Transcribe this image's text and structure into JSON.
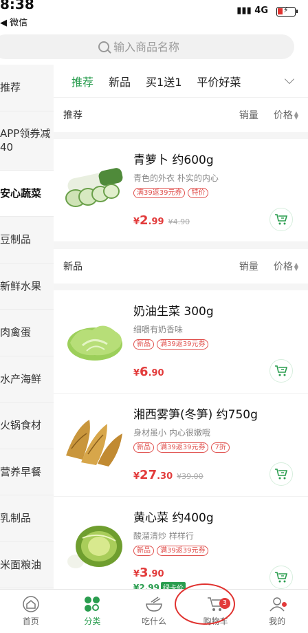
{
  "status_bar": {
    "time": "8:38",
    "back_label": "◀ 微信",
    "network": "4G"
  },
  "search": {
    "placeholder": "输入商品名称"
  },
  "sidebar": {
    "items": [
      {
        "label": "推荐"
      },
      {
        "label": "APP领券减40"
      },
      {
        "label": "安心蔬菜"
      },
      {
        "label": "豆制品"
      },
      {
        "label": "新鲜水果"
      },
      {
        "label": "肉禽蛋"
      },
      {
        "label": "水产海鲜"
      },
      {
        "label": "火锅食材"
      },
      {
        "label": "营养早餐"
      },
      {
        "label": "乳制品"
      },
      {
        "label": "米面粮油"
      }
    ],
    "active_index": 2
  },
  "tabs": [
    {
      "label": "推荐"
    },
    {
      "label": "新品"
    },
    {
      "label": "买1送1"
    },
    {
      "label": "平价好菜"
    }
  ],
  "sections": [
    {
      "title": "推荐",
      "sort_sales": "销量",
      "sort_price": "价格",
      "products": [
        {
          "name": "青萝卜 约600g",
          "desc": "青色的外衣 朴实的内心",
          "tags": [
            "满39返39元券",
            "特价"
          ],
          "price_int": "2",
          "price_dec": ".99",
          "price_orig": "¥4.90",
          "icon": "radish-image"
        }
      ]
    },
    {
      "title": "新品",
      "sort_sales": "销量",
      "sort_price": "价格",
      "products": [
        {
          "name": "奶油生菜 300g",
          "desc": "细嚼有奶香味",
          "tags": [
            "新品",
            "满39返39元券"
          ],
          "price_int": "6",
          "price_dec": ".90",
          "price_orig": "",
          "icon": "lettuce-image"
        },
        {
          "name": "湘西雾笋(冬笋) 约750g",
          "desc": "身材虽小 内心很嫩哦",
          "tags": [
            "新品",
            "满39返39元券",
            "7折"
          ],
          "price_int": "27",
          "price_dec": ".30",
          "price_orig": "¥39.00",
          "icon": "bamboo-shoot-image"
        },
        {
          "name": "黄心菜 约400g",
          "desc": "酸溜清炒 样样行",
          "tags": [
            "新品",
            "满39返39元券"
          ],
          "price_int": "3",
          "price_dec": ".90",
          "price_orig": "",
          "vip_price": "¥2.99",
          "vip_label": "绿卡价",
          "icon": "cabbage-image"
        }
      ]
    }
  ],
  "tabbar": [
    {
      "label": "首页",
      "icon": "home-icon"
    },
    {
      "label": "分类",
      "icon": "category-icon"
    },
    {
      "label": "吃什么",
      "icon": "bowl-icon"
    },
    {
      "label": "购物车",
      "icon": "cart-icon",
      "badge": "3"
    },
    {
      "label": "我的",
      "icon": "profile-icon"
    }
  ],
  "colors": {
    "accent": "#2a9d4f",
    "price": "#e23b3b",
    "tag": "#e0504d"
  }
}
